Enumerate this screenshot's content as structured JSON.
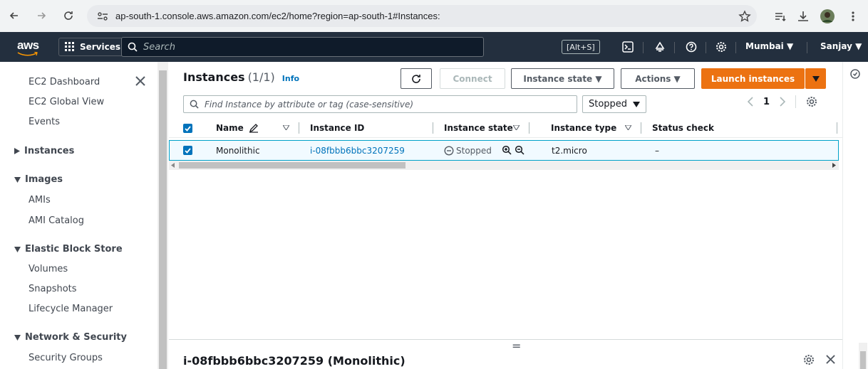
{
  "browser": {
    "url": "ap-south-1.console.aws.amazon.com/ec2/home?region=ap-south-1#Instances:"
  },
  "aws_nav": {
    "logo_text": "aws",
    "services_label": "Services",
    "search_placeholder": "Search",
    "search_shortcut": "[Alt+S]",
    "region": "Mumbai ▼",
    "user": "Sanjay ▼"
  },
  "sidebar": {
    "items": [
      {
        "label": "EC2 Dashboard"
      },
      {
        "label": "EC2 Global View"
      },
      {
        "label": "Events"
      }
    ],
    "instances_header": "Instances",
    "images_header": "Images",
    "images_items": [
      {
        "label": "AMIs"
      },
      {
        "label": "AMI Catalog"
      }
    ],
    "ebs_header": "Elastic Block Store",
    "ebs_items": [
      {
        "label": "Volumes"
      },
      {
        "label": "Snapshots"
      },
      {
        "label": "Lifecycle Manager"
      }
    ],
    "network_header": "Network & Security",
    "network_items": [
      {
        "label": "Security Groups"
      }
    ]
  },
  "instances_panel": {
    "title": "Instances",
    "count": "(1/1)",
    "info": "Info",
    "connect_label": "Connect",
    "state_label": "Instance state ▼",
    "actions_label": "Actions ▼",
    "launch_label": "Launch instances",
    "filter_placeholder": "Find Instance by attribute or tag (case-sensitive)",
    "state_filter": "Stopped",
    "page": "1",
    "columns": [
      "Name",
      "Instance ID",
      "Instance state",
      "Instance type",
      "Status check"
    ],
    "rows": [
      {
        "name": "Monolithic",
        "id": "i-08fbbb6bbc3207259",
        "state": "Stopped",
        "type": "t2.micro",
        "status": "–"
      }
    ]
  },
  "detail_panel": {
    "title": "i-08fbbb6bbc3207259 (Monolithic)",
    "handle": "="
  },
  "colors": {
    "aws_nav_bg": "#232f3e",
    "launch_orange": "#ec7211",
    "link_blue": "#0073bb",
    "selected_row_bg": "#f1faff"
  }
}
